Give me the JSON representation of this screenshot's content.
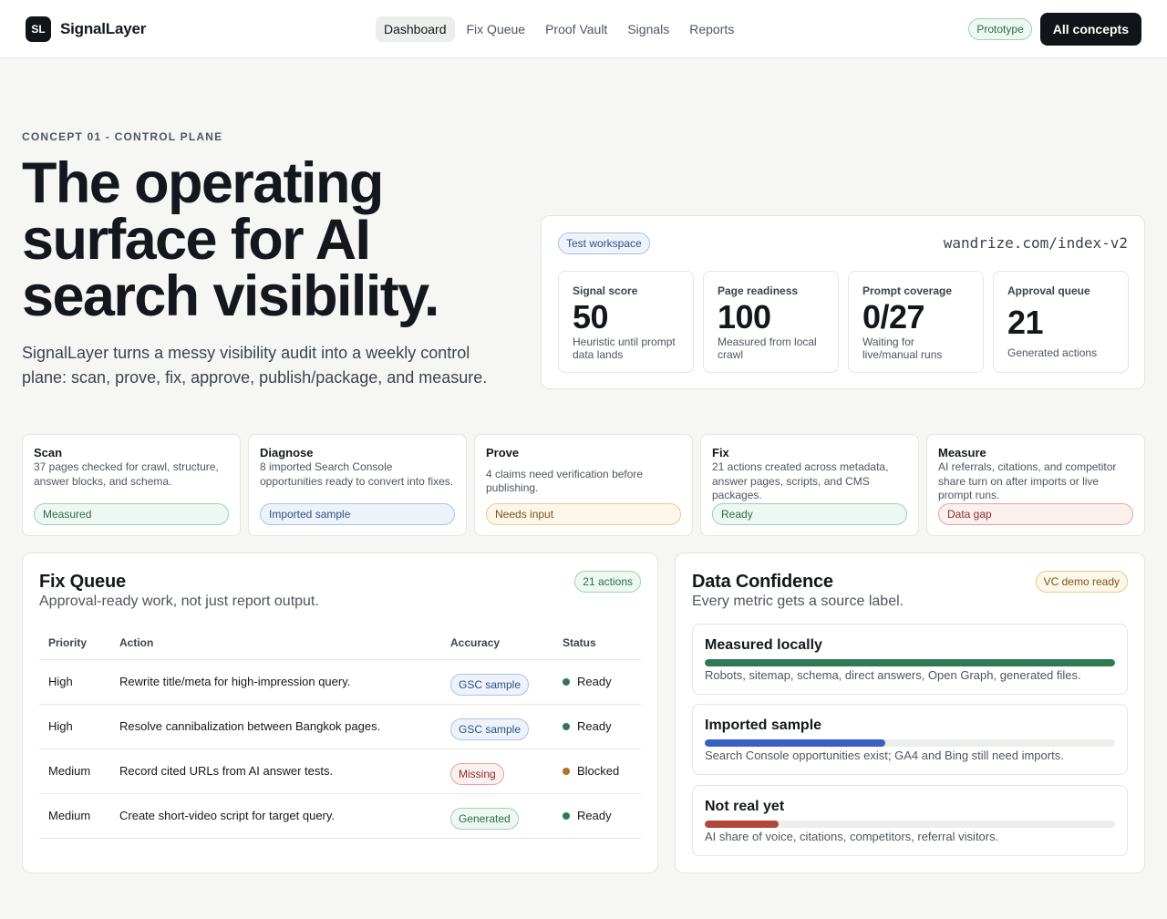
{
  "brand": {
    "mark": "SL",
    "name": "SignalLayer"
  },
  "nav": [
    "Dashboard",
    "Fix Queue",
    "Proof Vault",
    "Signals",
    "Reports"
  ],
  "header": {
    "status_pill": "Prototype",
    "all_concepts": "All concepts"
  },
  "hero": {
    "eyebrow": "CONCEPT 01 - CONTROL PLANE",
    "title": "The operating surface for AI search visibility.",
    "subtitle": "SignalLayer turns a messy visibility audit into a weekly control plane: scan, prove, fix, approve, publish/package, and measure."
  },
  "workspace": {
    "pill": "Test workspace",
    "url": "wandrize.com/index-v2",
    "metrics": [
      {
        "label": "Signal score",
        "value": "50",
        "note": "Heuristic until prompt data lands"
      },
      {
        "label": "Page readiness",
        "value": "100",
        "note": "Measured from local crawl"
      },
      {
        "label": "Prompt coverage",
        "value": "0/27",
        "note": "Waiting for live/manual runs"
      },
      {
        "label": "Approval queue",
        "value": "21",
        "note": "Generated actions"
      }
    ]
  },
  "stages": [
    {
      "title": "Scan",
      "desc": "37 pages checked for crawl, structure, answer blocks, and schema.",
      "pill": "Measured",
      "tone": "green"
    },
    {
      "title": "Diagnose",
      "desc": "8 imported Search Console opportunities ready to convert into fixes.",
      "pill": "Imported sample",
      "tone": "blue"
    },
    {
      "title": "Prove",
      "desc": "4 claims need verification before publishing.",
      "pill": "Needs input",
      "tone": "amber"
    },
    {
      "title": "Fix",
      "desc": "21 actions created across metadata, answer pages, scripts, and CMS packages.",
      "pill": "Ready",
      "tone": "green"
    },
    {
      "title": "Measure",
      "desc": "AI referrals, citations, and competitor share turn on after imports or live prompt runs.",
      "pill": "Data gap",
      "tone": "red"
    }
  ],
  "fix_queue": {
    "title": "Fix Queue",
    "subtitle": "Approval-ready work, not just report output.",
    "badge": "21 actions",
    "columns": [
      "Priority",
      "Action",
      "Accuracy",
      "Status"
    ],
    "rows": [
      {
        "priority": "High",
        "action": "Rewrite title/meta for high-impression query.",
        "accuracy": "GSC sample",
        "accuracy_tone": "blue",
        "status": "Ready",
        "status_color": "#2f7a55"
      },
      {
        "priority": "High",
        "action": "Resolve cannibalization between Bangkok pages.",
        "accuracy": "GSC sample",
        "accuracy_tone": "blue",
        "status": "Ready",
        "status_color": "#2f7a55"
      },
      {
        "priority": "Medium",
        "action": "Record cited URLs from AI answer tests.",
        "accuracy": "Missing",
        "accuracy_tone": "red",
        "status": "Blocked",
        "status_color": "#b0722a"
      },
      {
        "priority": "Medium",
        "action": "Create short-video script for target query.",
        "accuracy": "Generated",
        "accuracy_tone": "green",
        "status": "Ready",
        "status_color": "#2f7a55"
      }
    ]
  },
  "data_confidence": {
    "title": "Data Confidence",
    "subtitle": "Every metric gets a source label.",
    "badge": "VC demo ready",
    "items": [
      {
        "title": "Measured locally",
        "desc": "Robots, sitemap, schema, direct answers, Open Graph, generated files.",
        "fill": 1.0,
        "color": "#2f7a55"
      },
      {
        "title": "Imported sample",
        "desc": "Search Console opportunities exist; GA4 and Bing still need imports.",
        "fill": 0.44,
        "color": "#3a5fc4"
      },
      {
        "title": "Not real yet",
        "desc": "AI share of voice, citations, competitors, referral visitors.",
        "fill": 0.18,
        "color": "#b0463c"
      }
    ]
  }
}
